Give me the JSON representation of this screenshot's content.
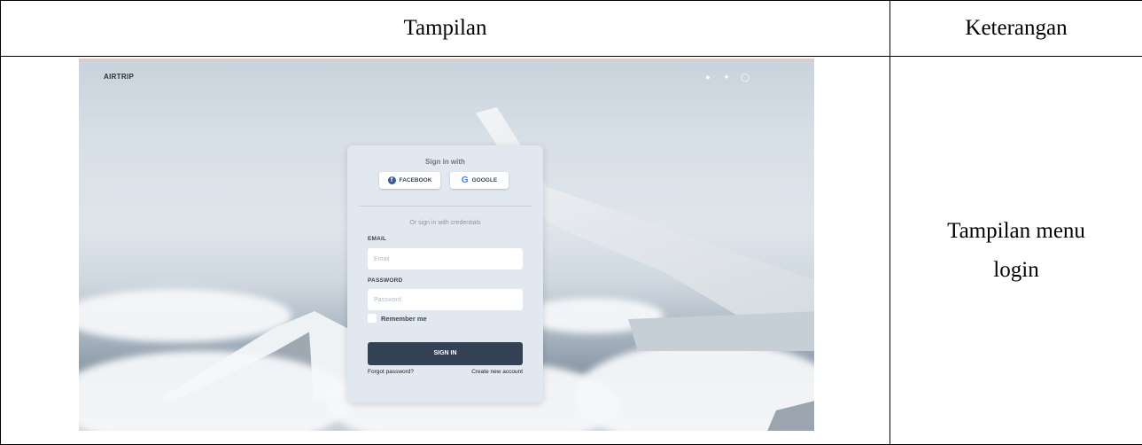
{
  "table": {
    "header_col1": "Tampilan",
    "header_col2": "Keterangan",
    "description_line1": "Tampilan menu",
    "description_line2": "login"
  },
  "app": {
    "brand": "AIRTRIP",
    "social_icons": [
      "facebook-icon",
      "twitter-icon",
      "github-icon"
    ],
    "login": {
      "sign_in_with": "Sign in with",
      "facebook_label": "FACEBOOK",
      "google_label": "GOOGLE",
      "or_credentials": "Or sign in with credentials",
      "email_label": "EMAIL",
      "email_placeholder": "Email",
      "email_value": "",
      "password_label": "PASSWORD",
      "password_placeholder": "Password",
      "password_value": "",
      "remember_label": "Remember me",
      "remember_checked": false,
      "signin_label": "SIGN IN",
      "forgot_label": "Forgot password?",
      "create_label": "Create new account"
    }
  },
  "colors": {
    "card_bg": "#e2e8ef",
    "signin_button": "#334155",
    "facebook": "#3b5998",
    "google": "#4285f4"
  }
}
